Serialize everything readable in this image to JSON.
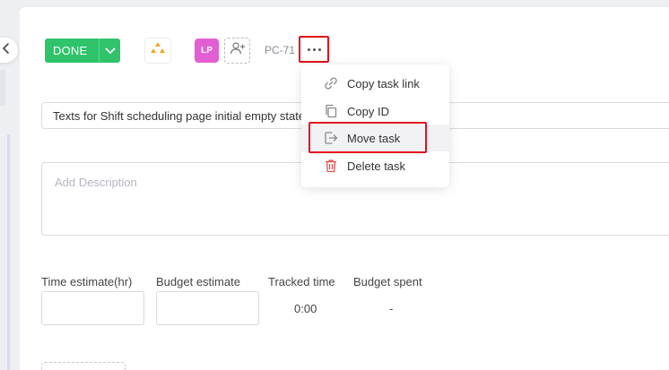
{
  "header": {
    "status_label": "DONE",
    "assignee_initials": "LP",
    "task_id": "PC-71"
  },
  "task": {
    "title": "Texts for Shift scheduling page initial empty state",
    "description_placeholder": "Add Description"
  },
  "fields": {
    "time_estimate_label": "Time estimate(hr)",
    "budget_estimate_label": "Budget estimate",
    "tracked_time_label": "Tracked time",
    "tracked_time_value": "0:00",
    "budget_spent_label": "Budget spent",
    "budget_spent_value": "-"
  },
  "menu": {
    "items": [
      {
        "label": "Copy task link",
        "icon": "link-icon"
      },
      {
        "label": "Copy ID",
        "icon": "copy-icon"
      },
      {
        "label": "Move task",
        "icon": "move-icon"
      },
      {
        "label": "Delete task",
        "icon": "trash-icon"
      }
    ]
  },
  "colors": {
    "status": "#2fc46b",
    "avatar": "#e25fd3",
    "priority": "#f5a623",
    "highlight": "#e3101e",
    "delete_icon": "#e64a4a"
  }
}
